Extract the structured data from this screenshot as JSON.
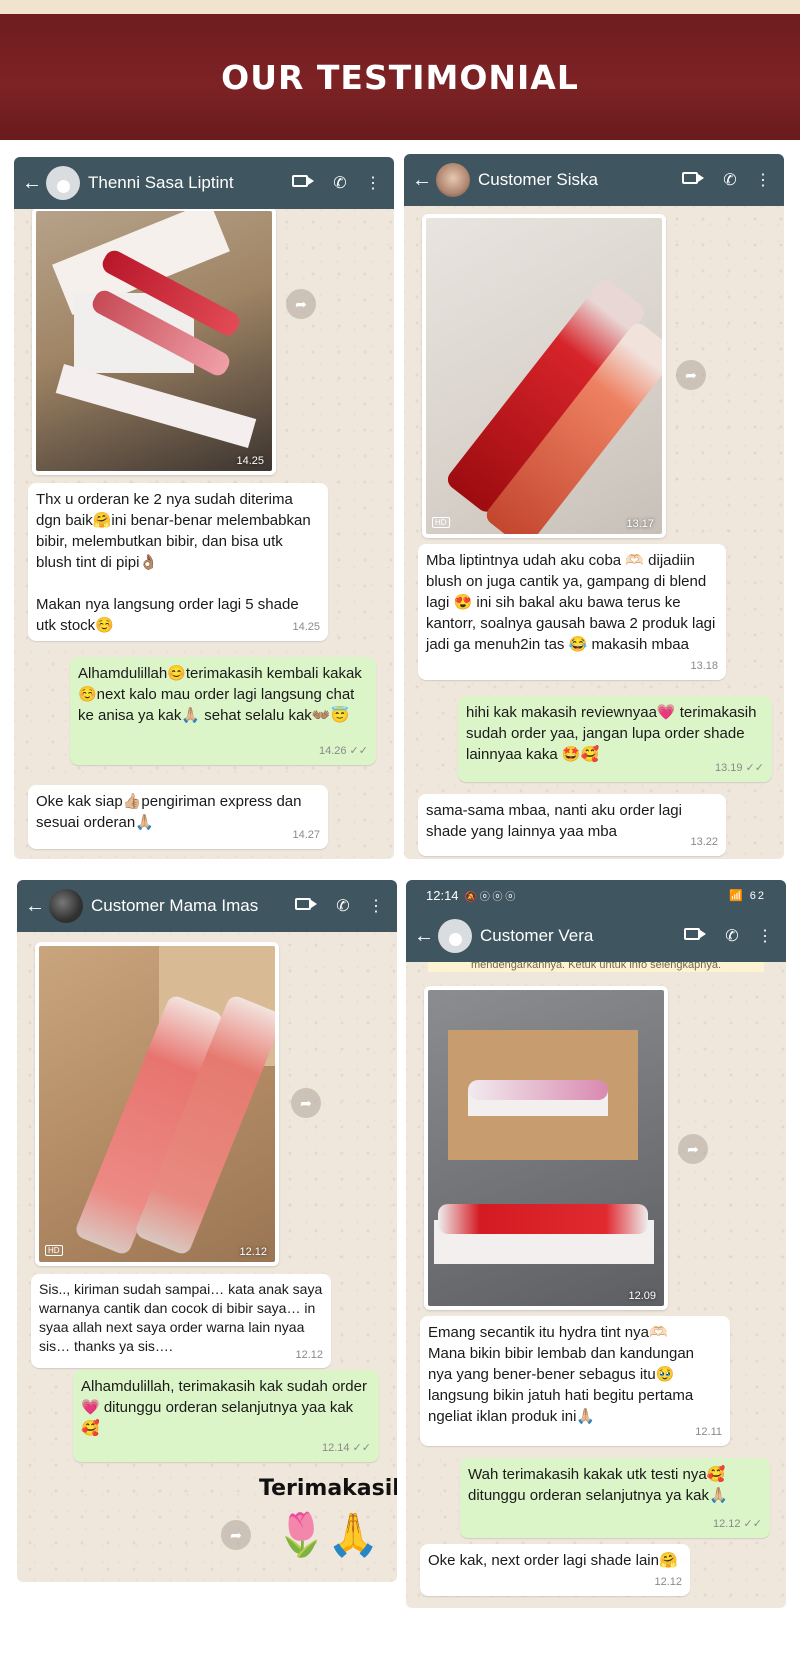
{
  "banner": {
    "title": "OUR TESTIMONIAL"
  },
  "chats": [
    {
      "name": "Thenni Sasa Liptint",
      "image_time": "14.25",
      "messages": [
        {
          "text": "Thx u orderan ke 2 nya sudah diterima dgn baik🤗ini benar-benar melembabkan bibir, melembutkan bibir, dan bisa utk blush tint di pipi👌🏽\n\nMakan nya langsung order lagi 5 shade utk stock☺️",
          "time": "14.25"
        },
        {
          "text": "Alhamdulillah😊terimakasih kembali kakak☺️next kalo mau order lagi langsung chat ke anisa ya kak🙏🏼 sehat selalu kak👐🏽😇",
          "time": "14.26 ✓✓"
        },
        {
          "text": "Oke kak siap👍🏼pengiriman express dan sesuai orderan🙏🏼",
          "time": "14.27"
        }
      ]
    },
    {
      "name": "Customer Siska",
      "image_time": "13.17",
      "image_badge": "HD",
      "messages": [
        {
          "text": "Mba liptintnya udah aku coba 🫶🏻 dijadiin blush on juga cantik ya, gampang di blend lagi 😍 ini sih bakal aku bawa terus ke kantorr, soalnya gausah bawa 2 produk lagi jadi ga menuh2in tas 😂 makasih mbaa",
          "time": "13.18"
        },
        {
          "text": "hihi kak makasih reviewnyaa💗 terimakasih sudah order yaa, jangan lupa order shade lainnyaa kaka 🤩🥰",
          "time": "13.19 ✓✓"
        },
        {
          "text": "sama-sama mbaa, nanti aku order lagi shade yang lainnya yaa mba",
          "time": "13.22"
        }
      ]
    },
    {
      "name": "Customer Mama Imas",
      "image_time": "12.12",
      "image_badge": "HD",
      "messages": [
        {
          "text": "Sis.., kiriman sudah sampai… kata anak saya warnanya cantik dan cocok di bibir saya… in syaa allah next saya order warna lain nyaa sis… thanks ya sis….",
          "time": "12.12"
        },
        {
          "text": "Alhamdulillah, terimakasih kak sudah order 💗 ditunggu orderan selanjutnya yaa kak 🥰",
          "time": "12.14 ✓✓"
        }
      ],
      "sticker_text": "Terimakasih",
      "sticker_emoji": "🌷🙏"
    },
    {
      "name": "Customer Vera",
      "status_time": "12:14",
      "status_icons": "🔕 ⓞ ⓞ ⓞ",
      "status_right": "📶 62",
      "notice": "mendengarkannya. Ketuk untuk info selengkapnya.",
      "image_time": "12.09",
      "messages": [
        {
          "text": "Emang secantik itu hydra tint nya🫶🏻\nMana bikin bibir lembab dan kandungan nya yang bener-bener sebagus itu🥹 langsung bikin jatuh hati begitu pertama ngeliat iklan produk ini🙏🏼",
          "time": "12.11"
        },
        {
          "text": "Wah terimakasih kakak utk testi nya🥰 ditunggu orderan selanjutnya ya kak🙏🏼",
          "time": "12.12 ✓✓"
        },
        {
          "text": "Oke kak, next order lagi shade lain🤗",
          "time": "12.12"
        }
      ]
    }
  ],
  "icons": {
    "back": "arrow-left-icon",
    "video": "video-call-icon",
    "phone": "phone-icon",
    "menu": "more-vertical-icon",
    "forward": "forward-icon"
  },
  "colors": {
    "header": "#3f5560",
    "banner": "#7a2124",
    "incoming": "#ffffff",
    "outgoing": "#dcf5c8",
    "chat_bg": "#efe7dc"
  }
}
